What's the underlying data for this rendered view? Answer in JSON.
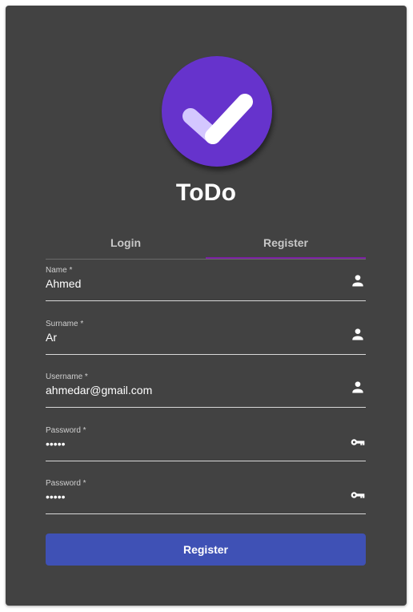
{
  "app": {
    "title": "ToDo"
  },
  "tabs": [
    {
      "label": "Login",
      "active": false
    },
    {
      "label": "Register",
      "active": true
    }
  ],
  "form": {
    "fields": [
      {
        "label": "Name *",
        "value": "Ahmed",
        "icon": "person-icon"
      },
      {
        "label": "Surname *",
        "value": "Ar",
        "icon": "person-icon"
      },
      {
        "label": "Username *",
        "value": "ahmedar@gmail.com",
        "icon": "person-icon"
      },
      {
        "label": "Password *",
        "value": "•••••",
        "icon": "key-icon"
      },
      {
        "label": "Password *",
        "value": "•••••",
        "icon": "key-icon"
      }
    ],
    "submit_label": "Register"
  },
  "colors": {
    "card_background": "#424242",
    "logo_background": "#6633cc",
    "tab_indicator": "#7b1fa2",
    "button_background": "#3f51b5"
  }
}
